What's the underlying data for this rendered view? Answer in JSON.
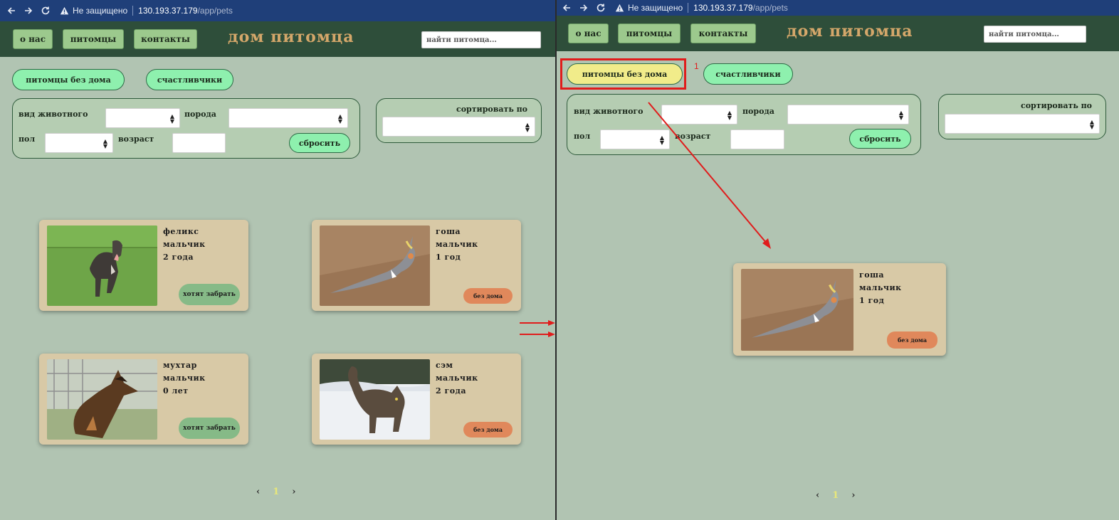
{
  "browser": {
    "warning": "Не защищено",
    "url_host": "130.193.37.179",
    "url_path": "/app/pets"
  },
  "site": {
    "title": "дом питомца",
    "nav": [
      "о нас",
      "питомцы",
      "контакты"
    ],
    "search_placeholder": "найти питомца..."
  },
  "filters": {
    "tab_homeless": "питомцы без дома",
    "tab_lucky": "счастливчики",
    "animal_type_label": "вид животного",
    "breed_label": "порода",
    "sex_label": "пол",
    "age_label": "возраст",
    "reset_label": "сбросить",
    "sort_label": "сортировать по"
  },
  "before": {
    "cards": [
      {
        "name": "феликс",
        "sex": "мальчик",
        "age": "2 года",
        "status": "хотят забрать",
        "photo": "dog-pitbull"
      },
      {
        "name": "гоша",
        "sex": "мальчик",
        "age": "1 год",
        "status": "без дома",
        "photo": "cockatiel"
      },
      {
        "name": "мухтар",
        "sex": "мальчик",
        "age": "0 лет",
        "status": "хотят забрать",
        "photo": "german-shepherd-puppy"
      },
      {
        "name": "сэм",
        "sex": "мальчик",
        "age": "2 года",
        "status": "без дома",
        "photo": "cat-in-snow"
      }
    ],
    "page": "1"
  },
  "after": {
    "cards": [
      {
        "name": "гоша",
        "sex": "мальчик",
        "age": "1 год",
        "status": "без дома",
        "photo": "cockatiel"
      }
    ],
    "page": "1"
  },
  "pager": {
    "prev": "‹",
    "next": "›"
  },
  "annotation": {
    "label": "1",
    "color": "#e01c1c"
  },
  "colors": {
    "page_bg": "#b1c4b2",
    "header_bg": "#2e4e3a",
    "title": "#d4a76a",
    "pill_green": "#8ef0ae",
    "pill_active": "#f1ec8a",
    "card_bg": "#d8c9a6",
    "status_want": "#86ba87",
    "status_homeless": "#e0885b"
  }
}
